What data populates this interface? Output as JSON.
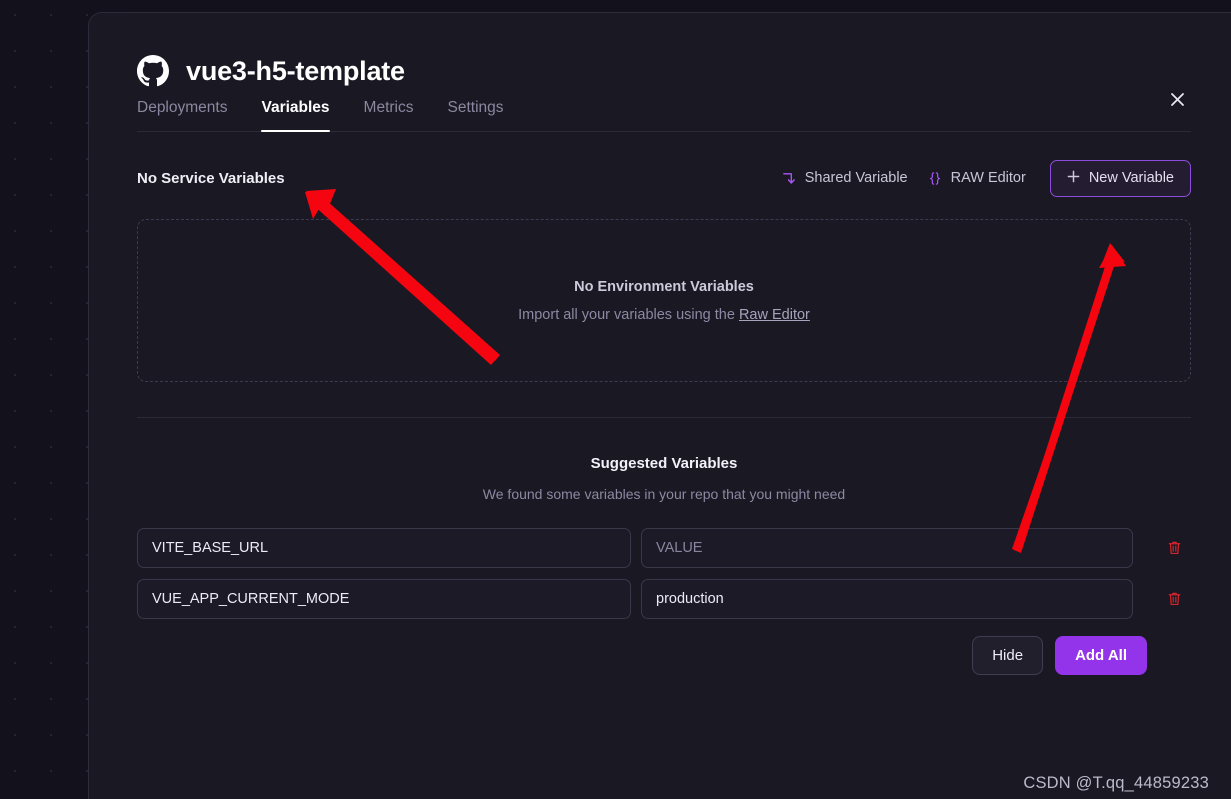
{
  "window": {
    "title": "vue3-h5-template",
    "repo_icon": "github-icon",
    "close_icon": "close-icon"
  },
  "tabs": [
    {
      "label": "Deployments",
      "active": false
    },
    {
      "label": "Variables",
      "active": true
    },
    {
      "label": "Metrics",
      "active": false
    },
    {
      "label": "Settings",
      "active": false
    }
  ],
  "actions": {
    "section_heading": "No Service Variables",
    "shared_variable": {
      "label": "Shared Variable",
      "icon": "arrow-turn-down-icon"
    },
    "raw_editor": {
      "label": "RAW Editor",
      "icon": "curly-braces-icon"
    },
    "new_variable": {
      "label": "New Variable",
      "icon": "plus-icon"
    }
  },
  "empty_state": {
    "title": "No Environment Variables",
    "subtitle_prefix": "Import all your variables using the ",
    "subtitle_link": "Raw Editor"
  },
  "suggested": {
    "title": "Suggested Variables",
    "subtitle": "We found some variables in your repo that you might need",
    "value_placeholder": "VALUE",
    "delete_icon": "trash-icon",
    "rows": [
      {
        "name": "VITE_BASE_URL",
        "value": "",
        "value_is_placeholder": true
      },
      {
        "name": "VUE_APP_CURRENT_MODE",
        "value": "production",
        "value_is_placeholder": false
      }
    ],
    "hide_label": "Hide",
    "add_all_label": "Add All"
  },
  "annotations": {
    "arrow_color": "#f5050f",
    "arrow_1_target": "variables-tab",
    "arrow_2_target": "new-variable-button"
  },
  "watermark": "CSDN @T.qq_44859233",
  "colors": {
    "background": "#13111c",
    "panel": "#1a1822",
    "accent_purple": "#9333ea",
    "accent_purple_border": "#8b4ddb",
    "danger_red": "#d4242e",
    "text_primary": "#ffffff",
    "text_muted": "#8d88a3"
  }
}
